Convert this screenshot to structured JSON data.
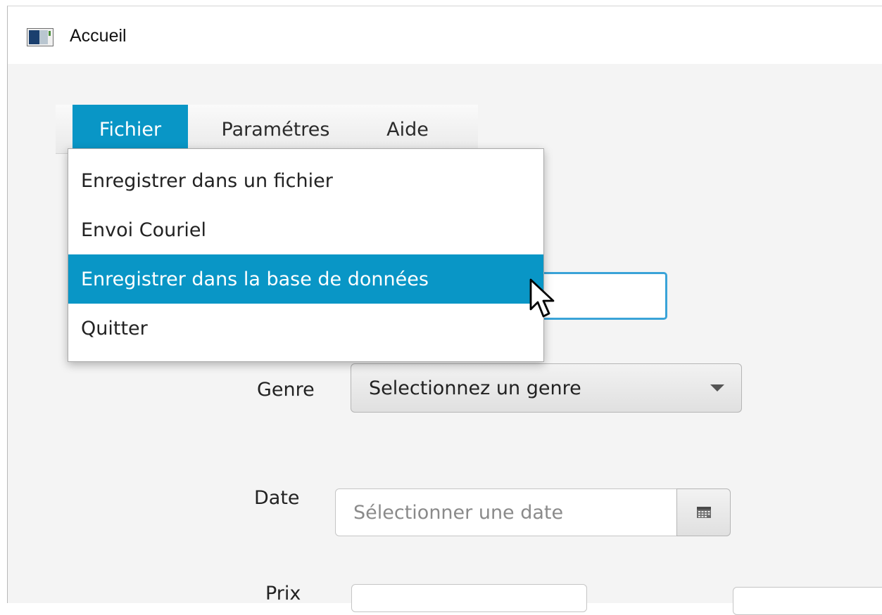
{
  "window": {
    "title": "Accueil"
  },
  "menubar": {
    "items": [
      {
        "label": "Fichier",
        "state": "open"
      },
      {
        "label": "Paramétres"
      },
      {
        "label": "Aide"
      }
    ]
  },
  "fichier_menu": {
    "items": [
      {
        "label": "Enregistrer dans un fichier"
      },
      {
        "label": "Envoi Couriel"
      },
      {
        "label": "Enregistrer dans la base de données",
        "state": "hovered"
      },
      {
        "label": "Quitter"
      }
    ]
  },
  "form": {
    "genre": {
      "label": "Genre",
      "selected": "Selectionnez un genre"
    },
    "date": {
      "label": "Date",
      "placeholder": "Sélectionner une date"
    },
    "prix": {
      "label": "Prix"
    }
  },
  "colors": {
    "accent": "#0996c6",
    "focus_border": "#3aa3d8"
  },
  "icons": {
    "window": "app-window-icon",
    "combo_arrow": "chevron-down-icon",
    "date_picker": "calendar-icon",
    "cursor": "mouse-pointer-icon"
  }
}
